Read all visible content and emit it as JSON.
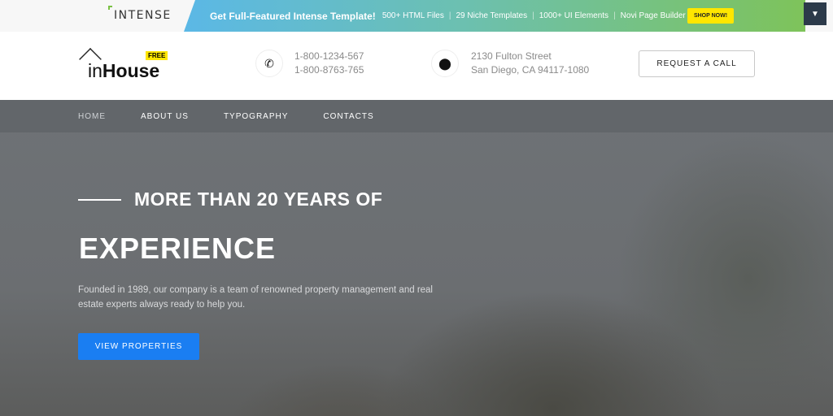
{
  "topbar": {
    "brand": "INTENSE",
    "promo_title": "Get Full-Featured Intense Template!",
    "features": [
      "500+ HTML Files",
      "29 Niche Templates",
      "1000+ UI Elements",
      "Novi Page Builder"
    ],
    "shop_label": "SHOP NOW!",
    "dropdown_icon": "caret-down-icon"
  },
  "header": {
    "logo_light": "in",
    "logo_bold": "House",
    "logo_badge": "FREE",
    "phones": [
      "1-800-1234-567",
      "1-800-8763-765"
    ],
    "address": [
      "2130 Fulton Street",
      "San Diego, CA 94117-1080"
    ],
    "request_label": "REQUEST A CALL"
  },
  "nav": {
    "items": [
      "HOME",
      "ABOUT US",
      "TYPOGRAPHY",
      "CONTACTS"
    ],
    "active": "HOME"
  },
  "hero": {
    "title_line1": "MORE THAN 20 YEARS OF",
    "title_line2": "EXPERIENCE",
    "text": "Founded in 1989, our company is a team of renowned property management and real estate experts always ready to help you.",
    "button_label": "VIEW PROPERTIES"
  },
  "colors": {
    "accent": "#1a7ef2",
    "badge": "#ffe600"
  }
}
